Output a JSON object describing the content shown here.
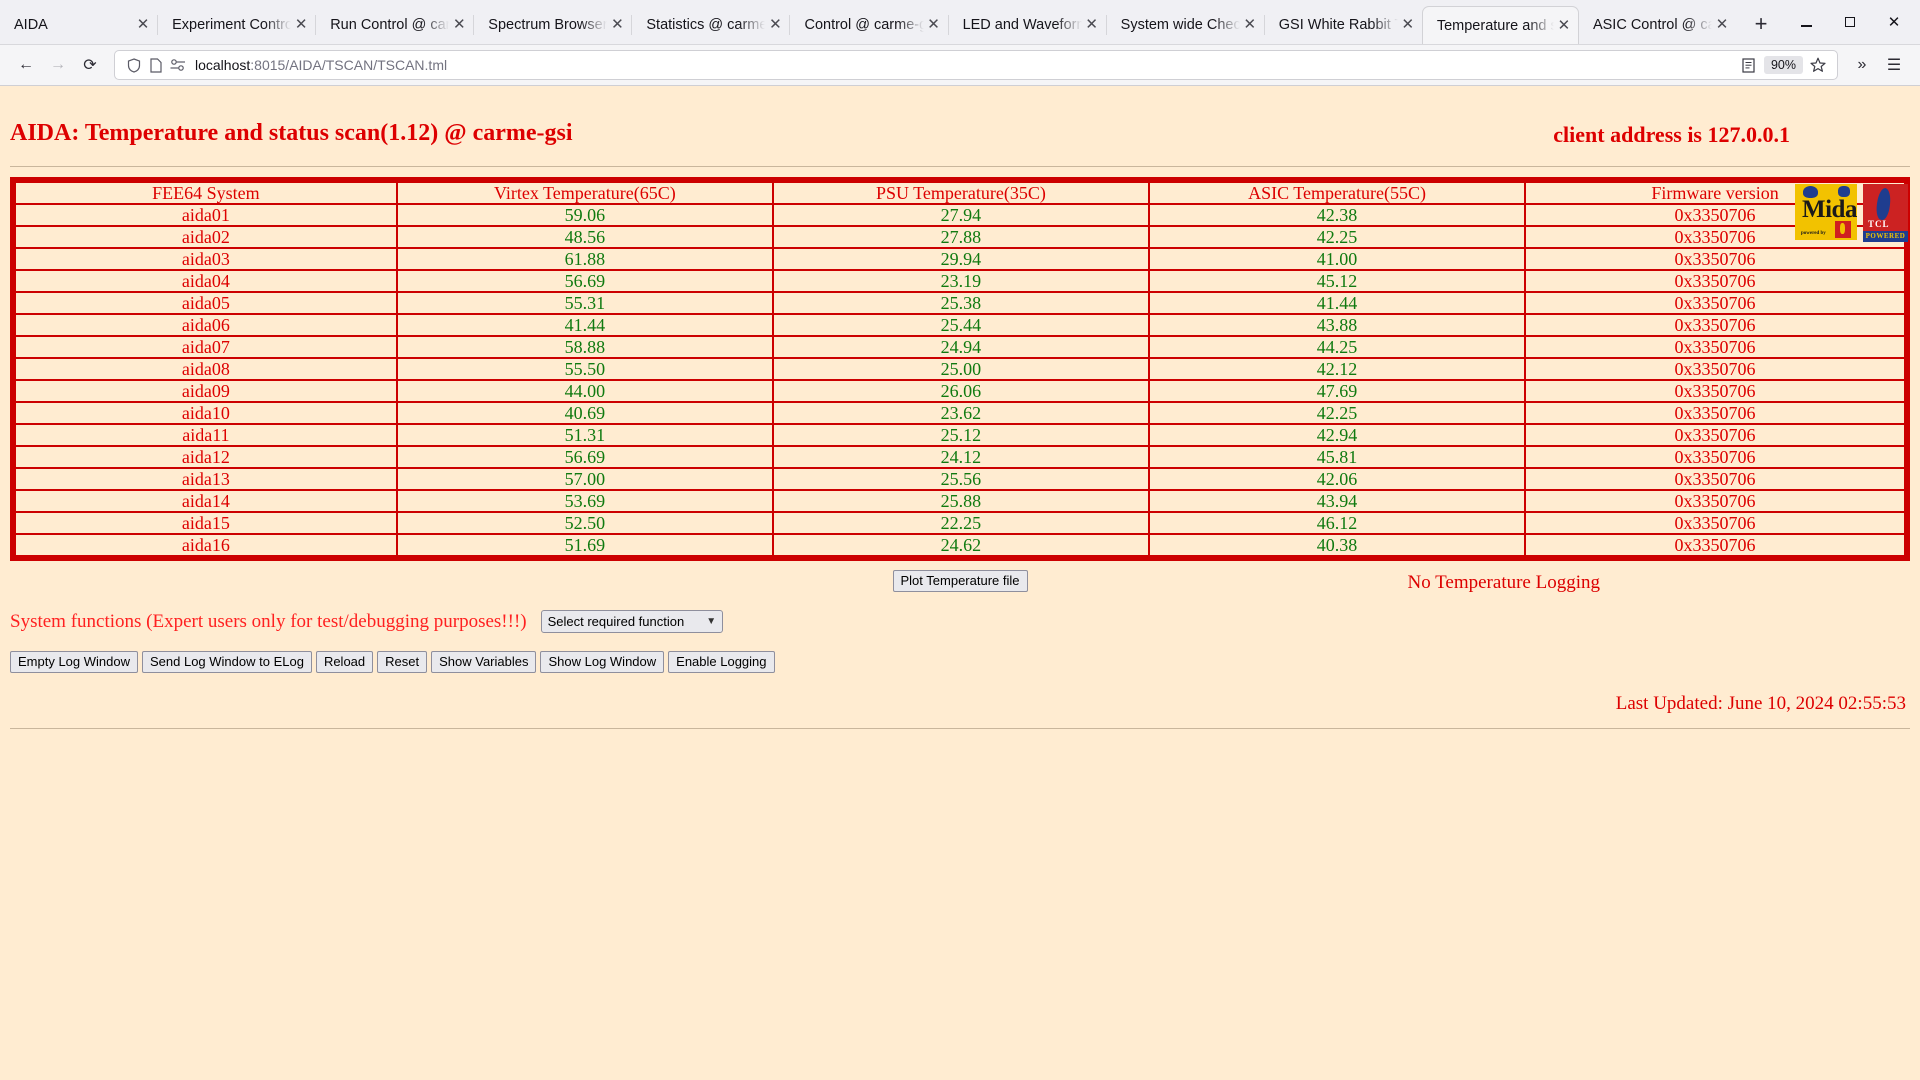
{
  "browser": {
    "tabs": [
      {
        "label": "AIDA",
        "active": false
      },
      {
        "label": "Experiment Control",
        "active": false
      },
      {
        "label": "Run Control @ carme",
        "active": false
      },
      {
        "label": "Spectrum Browser",
        "active": false
      },
      {
        "label": "Statistics @ carme",
        "active": false
      },
      {
        "label": "Control @ carme-gsi",
        "active": false
      },
      {
        "label": "LED and Waveform",
        "active": false
      },
      {
        "label": "System wide Check",
        "active": false
      },
      {
        "label": "GSI White Rabbit Ti",
        "active": false
      },
      {
        "label": "Temperature and st",
        "active": true
      },
      {
        "label": "ASIC Control @ car",
        "active": false
      }
    ],
    "close_glyph": "✕",
    "new_tab_label": "+",
    "window_controls": {
      "minimize": "minimize-button",
      "maximize": "maximize-button",
      "close": "close-button"
    },
    "nav": {
      "back": "←",
      "forward": "→",
      "reload": "⟳"
    },
    "url": {
      "host": "localhost",
      "path": ":8015/AIDA/TSCAN/TSCAN.tml",
      "full": "localhost:8015/AIDA/TSCAN/TSCAN.tml"
    },
    "zoom_level": "90%",
    "toolbar_icons": {
      "shield": "shield-icon",
      "reader": "reader-view-icon",
      "permissions": "site-permissions-icon",
      "bookmark": "star-icon",
      "overflow": "»",
      "menu": "☰"
    }
  },
  "page": {
    "title": "AIDA: Temperature and status scan(1.12) @ carme-gsi",
    "client_address": "client address is 127.0.0.1",
    "logos": {
      "midas": {
        "name": "Midas",
        "sub": "powered by",
        "alt": "midas-logo"
      },
      "tcl": {
        "name": "TCL",
        "powered": "POWERED",
        "alt": "tcl-powered-logo"
      }
    },
    "table": {
      "columns": [
        "FEE64 System",
        "Virtex Temperature(65C)",
        "PSU Temperature(35C)",
        "ASIC Temperature(55C)",
        "Firmware version"
      ],
      "rows": [
        [
          "aida01",
          "59.06",
          "27.94",
          "42.38",
          "0x3350706"
        ],
        [
          "aida02",
          "48.56",
          "27.88",
          "42.25",
          "0x3350706"
        ],
        [
          "aida03",
          "61.88",
          "29.94",
          "41.00",
          "0x3350706"
        ],
        [
          "aida04",
          "56.69",
          "23.19",
          "45.12",
          "0x3350706"
        ],
        [
          "aida05",
          "55.31",
          "25.38",
          "41.44",
          "0x3350706"
        ],
        [
          "aida06",
          "41.44",
          "25.44",
          "43.88",
          "0x3350706"
        ],
        [
          "aida07",
          "58.88",
          "24.94",
          "44.25",
          "0x3350706"
        ],
        [
          "aida08",
          "55.50",
          "25.00",
          "42.12",
          "0x3350706"
        ],
        [
          "aida09",
          "44.00",
          "26.06",
          "47.69",
          "0x3350706"
        ],
        [
          "aida10",
          "40.69",
          "23.62",
          "42.25",
          "0x3350706"
        ],
        [
          "aida11",
          "51.31",
          "25.12",
          "42.94",
          "0x3350706"
        ],
        [
          "aida12",
          "56.69",
          "24.12",
          "45.81",
          "0x3350706"
        ],
        [
          "aida13",
          "57.00",
          "25.56",
          "42.06",
          "0x3350706"
        ],
        [
          "aida14",
          "53.69",
          "25.88",
          "43.94",
          "0x3350706"
        ],
        [
          "aida15",
          "52.50",
          "22.25",
          "46.12",
          "0x3350706"
        ],
        [
          "aida16",
          "51.69",
          "24.62",
          "40.38",
          "0x3350706"
        ]
      ]
    },
    "controls": {
      "plot_button": "Plot Temperature file",
      "logging_status": "No Temperature Logging",
      "sysfn_label": "System functions (Expert users only for test/debugging purposes!!!)",
      "sysfn_select_value": "Select required function",
      "buttons": [
        "Empty Log Window",
        "Send Log Window to ELog",
        "Reload",
        "Reset",
        "Show Variables",
        "Show Log Window",
        "Enable Logging"
      ]
    },
    "last_updated": "Last Updated: June 10, 2024 02:55:53"
  },
  "colors": {
    "page_background": "#ffecd1",
    "accent_red": "#dd0000",
    "value_green": "#107a10",
    "table_border": "#cc0000"
  }
}
